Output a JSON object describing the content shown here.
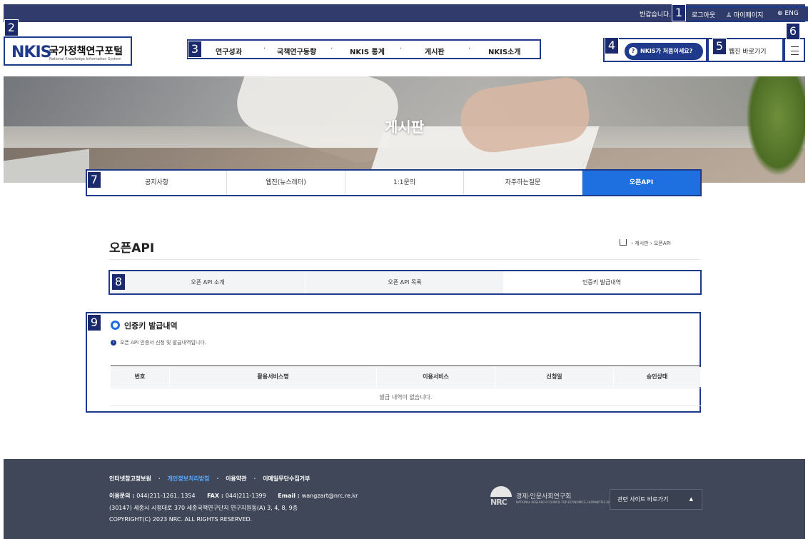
{
  "topbar": {
    "greeting": "반갑습니다.",
    "logout": "로그아웃",
    "mypage": "마이페이지",
    "lang": "ENG"
  },
  "badges": [
    "1",
    "2",
    "3",
    "4",
    "5",
    "6",
    "7",
    "8",
    "9"
  ],
  "logo": {
    "mark": "NKIS",
    "title": "국가정책연구포털",
    "subtitle": "National Knowledge Information System"
  },
  "gnb": {
    "items": [
      "연구성과",
      "국책연구동향",
      "NKIS 통계",
      "게시판",
      "NKIS소개"
    ],
    "separator": "·"
  },
  "header": {
    "help_label": "NKIS가 처음이세요?",
    "help_icon_glyph": "?",
    "webzine_label": "웹진 바로가기"
  },
  "hero": {
    "title": "게시판"
  },
  "board_tabs": [
    {
      "label": "공지사항",
      "active": false
    },
    {
      "label": "웹진(뉴스레터)",
      "active": false
    },
    {
      "label": "1:1문의",
      "active": false
    },
    {
      "label": "자주하는질문",
      "active": false
    },
    {
      "label": "오픈API",
      "active": true
    }
  ],
  "main": {
    "title": "오픈API",
    "breadcrumb": [
      "게시판",
      "오픈API"
    ],
    "breadcrumb_sep": "›"
  },
  "sub_tabs": [
    {
      "label": "오픈 API 소개",
      "active": false
    },
    {
      "label": "오픈 API 목록",
      "active": false
    },
    {
      "label": "인증키 발급내역",
      "active": true
    }
  ],
  "section": {
    "title": "인증키 발급내역",
    "info": "오픈 API 인증서 신청 및 발급내역입니다.",
    "columns": [
      "번호",
      "활용서비스명",
      "이용서비스",
      "신청일",
      "승인상태"
    ],
    "empty_text": "발급 내역이 없습니다."
  },
  "footer": {
    "links": [
      "인터넷참고정보원",
      "개인정보처리방침",
      "이용약관",
      "이메일무단수집거부"
    ],
    "link_sep": "·",
    "contact_label": "이용문의 : ",
    "contact_value": "044)211-1261, 1354",
    "fax_label": "FAX : ",
    "fax_value": "044)211-1399",
    "email_label": "Email : ",
    "email_value": "wangzart@nrc.re.kr",
    "address": "(30147) 세종시 시청대로 370 세종국책연구단지 연구지원동(A) 3, 4, 8, 9층",
    "copyright": "COPYRIGHT(C) 2023 NRC. ALL RIGHTS RESERVED.",
    "nrc_mark": "NRC",
    "nrc_name": "경제·인문사회연구회",
    "nrc_sub": "NATIONAL RESEARCH COUNCIL FOR ECONOMICS, HUMANITIES AND SOCIAL SCIENCES",
    "related_label": "관련 사이트 바로가기",
    "related_caret": "▲"
  },
  "colors": {
    "brand": "#1f3a8a",
    "active_tab": "#1e6fe0",
    "topbar": "#323c6c",
    "footer": "#3f4758"
  }
}
